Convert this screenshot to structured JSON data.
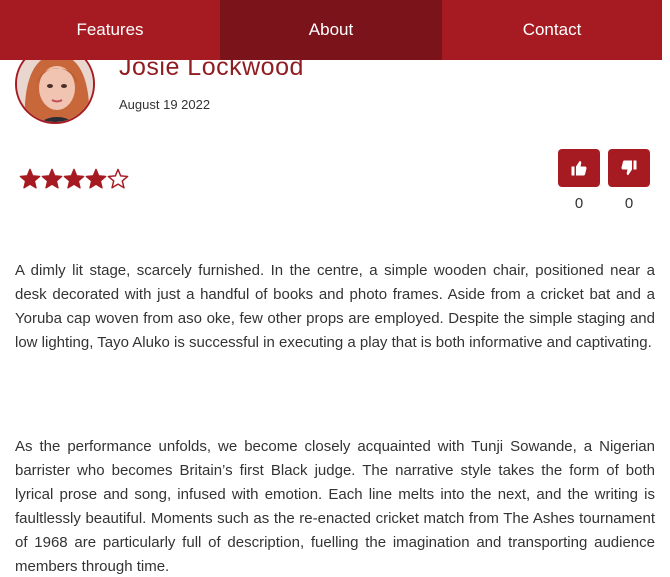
{
  "nav": {
    "tabs": [
      {
        "label": "Features"
      },
      {
        "label": "About"
      },
      {
        "label": "Contact"
      }
    ]
  },
  "review": {
    "author": "Josie Lockwood",
    "date": "August 19 2022",
    "rating": 4,
    "rating_max": 5,
    "likes": "0",
    "dislikes": "0"
  },
  "body": {
    "paragraphs": [
      "A dimly lit stage, scarcely furnished. In the centre, a simple wooden chair, positioned near a desk decorated with just a handful of books and photo frames. Aside from a cricket bat and a Yoruba cap woven from aso oke, few other props are employed. Despite the simple staging and low lighting, Tayo Aluko is successful in executing a play that is both informative and captivating.",
      "As the performance unfolds, we become closely acquainted with Tunji Sowande, a Nigerian barrister who becomes Britain’s first Black judge. The narrative style takes the form of both lyrical prose and song, infused with emotion. Each line melts into the next, and the writing is faultlessly beautiful. Moments such as the re-enacted cricket match from The Ashes tournament of 1968 are particularly full of description, fuelling the imagination and transporting audience members through time."
    ]
  },
  "colors": {
    "brand": "#a61b22",
    "brand_dark": "#7a141a",
    "text": "#333333"
  },
  "icons": {
    "like": "thumbs-up-icon",
    "dislike": "thumbs-down-icon",
    "star_filled": "star-filled-icon",
    "star_empty": "star-outline-icon"
  }
}
